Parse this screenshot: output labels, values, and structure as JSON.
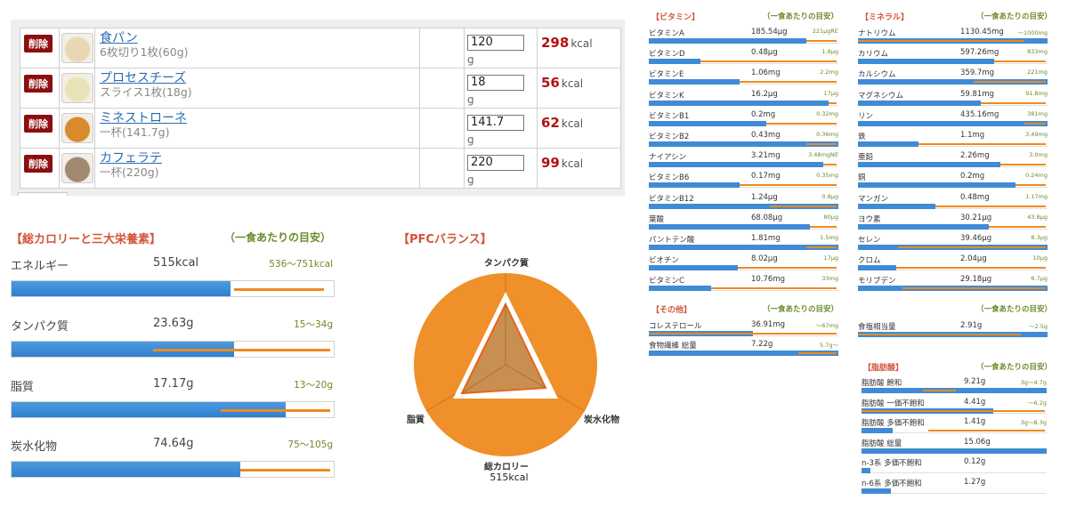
{
  "foods": [
    {
      "delete_label": "削除",
      "name": "食パン",
      "portion": "6枚切り1枚(60g)",
      "qty": "120",
      "unit": "g",
      "kcal": "298",
      "kcal_unit": "kcal",
      "thumb_color": "#e9d7b4"
    },
    {
      "delete_label": "削除",
      "name": "プロセスチーズ",
      "portion": "スライス1枚(18g)",
      "qty": "18",
      "unit": "g",
      "kcal": "56",
      "kcal_unit": "kcal",
      "thumb_color": "#ece2b8"
    },
    {
      "delete_label": "削除",
      "name": "ミネストローネ",
      "portion": "一杯(141.7g)",
      "qty": "141.7",
      "unit": "g",
      "kcal": "62",
      "kcal_unit": "kcal",
      "thumb_color": "#d98a2a"
    },
    {
      "delete_label": "削除",
      "name": "カフェラテ",
      "portion": "一杯(220g)",
      "qty": "220",
      "unit": "g",
      "kcal": "99",
      "kcal_unit": "kcal",
      "thumb_color": "#a08a70"
    }
  ],
  "macros": {
    "title": "【総カロリーと三大栄養素】",
    "guide_title": "（一食あたりの目安）",
    "rows": [
      {
        "label": "エネルギー",
        "value": "515kcal",
        "guide": "536〜751kcal",
        "fill": 0.68,
        "guide_min": 0.69,
        "guide_max": 0.97
      },
      {
        "label": "タンパク質",
        "value": "23.63g",
        "guide": "15〜34g",
        "fill": 0.69,
        "guide_min": 0.44,
        "guide_max": 0.99
      },
      {
        "label": "脂質",
        "value": "17.17g",
        "guide": "13〜20g",
        "fill": 0.85,
        "guide_min": 0.65,
        "guide_max": 0.99
      },
      {
        "label": "炭水化物",
        "value": "74.64g",
        "guide": "75〜105g",
        "fill": 0.71,
        "guide_min": 0.71,
        "guide_max": 0.99
      }
    ]
  },
  "pfc": {
    "title": "【PFCバランス】",
    "label_top": "タンパク質",
    "label_left": "脂質",
    "label_right": "炭水化物",
    "label_bottom": "総カロリー",
    "label_bottom_value": "515kcal",
    "colors": {
      "outer": "#ef8f2a",
      "inner": "#c9914f"
    }
  },
  "vitamins": {
    "title": "【ビタミン】",
    "guide_title": "（一食あたりの目安）",
    "rows": [
      {
        "label": "ビタミンA",
        "value": "185.54μg",
        "guide": "221μgRE",
        "fill": 0.83,
        "guide_min": 0.83,
        "guide_max": 0.99
      },
      {
        "label": "ビタミンD",
        "value": "0.48μg",
        "guide": "1.8μg",
        "fill": 0.27,
        "guide_min": 0.27,
        "guide_max": 0.99
      },
      {
        "label": "ビタミンE",
        "value": "1.06mg",
        "guide": "2.2mg",
        "fill": 0.48,
        "guide_min": 0.48,
        "guide_max": 0.99
      },
      {
        "label": "ビタミンK",
        "value": "16.2μg",
        "guide": "17μg",
        "fill": 0.95,
        "guide_min": 0.95,
        "guide_max": 0.99
      },
      {
        "label": "ビタミンB1",
        "value": "0.2mg",
        "guide": "0.32mg",
        "fill": 0.62,
        "guide_min": 0.62,
        "guide_max": 0.99
      },
      {
        "label": "ビタミンB2",
        "value": "0.43mg",
        "guide": "0.36mg",
        "fill": 1.0,
        "guide_min": 0.83,
        "guide_max": 0.99
      },
      {
        "label": "ナイアシン",
        "value": "3.21mg",
        "guide": "3.48mgNE",
        "fill": 0.92,
        "guide_min": 0.92,
        "guide_max": 0.99
      },
      {
        "label": "ビタミンB6",
        "value": "0.17mg",
        "guide": "0.35mg",
        "fill": 0.48,
        "guide_min": 0.48,
        "guide_max": 0.99
      },
      {
        "label": "ビタミンB12",
        "value": "1.24μg",
        "guide": "0.8μg",
        "fill": 1.0,
        "guide_min": 0.64,
        "guide_max": 0.99
      },
      {
        "label": "葉酸",
        "value": "68.08μg",
        "guide": "80μg",
        "fill": 0.85,
        "guide_min": 0.85,
        "guide_max": 0.99
      },
      {
        "label": "パントテン酸",
        "value": "1.81mg",
        "guide": "1.5mg",
        "fill": 1.0,
        "guide_min": 0.83,
        "guide_max": 0.99
      },
      {
        "label": "ビオチン",
        "value": "8.02μg",
        "guide": "17μg",
        "fill": 0.47,
        "guide_min": 0.47,
        "guide_max": 0.99
      },
      {
        "label": "ビタミンC",
        "value": "10.76mg",
        "guide": "33mg",
        "fill": 0.33,
        "guide_min": 0.33,
        "guide_max": 0.99
      }
    ]
  },
  "minerals": {
    "title": "【ミネラル】",
    "guide_title": "（一食あたりの目安）",
    "rows": [
      {
        "label": "ナトリウム",
        "value": "1130.45mg",
        "guide": "〜1000mg",
        "fill": 1.0,
        "guide_min": 0.0,
        "guide_max": 0.88
      },
      {
        "label": "カリウム",
        "value": "597.26mg",
        "guide": "833mg",
        "fill": 0.72,
        "guide_min": 0.72,
        "guide_max": 0.99
      },
      {
        "label": "カルシウム",
        "value": "359.7mg",
        "guide": "221mg",
        "fill": 1.0,
        "guide_min": 0.61,
        "guide_max": 0.99
      },
      {
        "label": "マグネシウム",
        "value": "59.81mg",
        "guide": "91.8mg",
        "fill": 0.65,
        "guide_min": 0.65,
        "guide_max": 0.99
      },
      {
        "label": "リン",
        "value": "435.16mg",
        "guide": "381mg",
        "fill": 1.0,
        "guide_min": 0.88,
        "guide_max": 0.99
      },
      {
        "label": "鉄",
        "value": "1.1mg",
        "guide": "3.49mg",
        "fill": 0.32,
        "guide_min": 0.32,
        "guide_max": 0.99
      },
      {
        "label": "亜鉛",
        "value": "2.26mg",
        "guide": "3.0mg",
        "fill": 0.75,
        "guide_min": 0.75,
        "guide_max": 0.99
      },
      {
        "label": "銅",
        "value": "0.2mg",
        "guide": "0.24mg",
        "fill": 0.83,
        "guide_min": 0.83,
        "guide_max": 0.99
      },
      {
        "label": "マンガン",
        "value": "0.48mg",
        "guide": "1.17mg",
        "fill": 0.41,
        "guide_min": 0.41,
        "guide_max": 0.99
      },
      {
        "label": "ヨウ素",
        "value": "30.21μg",
        "guide": "43.8μg",
        "fill": 0.69,
        "guide_min": 0.69,
        "guide_max": 0.99
      },
      {
        "label": "セレン",
        "value": "39.46μg",
        "guide": "8.3μg",
        "fill": 1.0,
        "guide_min": 0.21,
        "guide_max": 0.99
      },
      {
        "label": "クロム",
        "value": "2.04μg",
        "guide": "10μg",
        "fill": 0.2,
        "guide_min": 0.2,
        "guide_max": 0.99
      },
      {
        "label": "モリブデン",
        "value": "29.18μg",
        "guide": "6.7μg",
        "fill": 1.0,
        "guide_min": 0.23,
        "guide_max": 0.99
      }
    ]
  },
  "others": {
    "title": "【その他】",
    "guide_title": "（一食あたりの目安）",
    "rows": [
      {
        "label": "コレステロール",
        "value": "36.91mg",
        "guide": "〜67mg",
        "fill": 0.55,
        "guide_min": 0.0,
        "guide_max": 0.99
      },
      {
        "label": "食物繊維 総量",
        "value": "7.22g",
        "guide": "5.7g〜",
        "fill": 1.0,
        "guide_min": 0.79,
        "guide_max": 0.99
      }
    ]
  },
  "salt": {
    "guide_title": "（一食あたりの目安）",
    "rows": [
      {
        "label": "食塩相当量",
        "value": "2.91g",
        "guide": "〜2.5g",
        "fill": 1.0,
        "guide_min": 0.0,
        "guide_max": 0.86
      }
    ]
  },
  "fats": {
    "title": "【脂肪酸】",
    "guide_title": "（一食あたりの目安）",
    "rows": [
      {
        "label": "脂肪酸 飽和",
        "value": "9.21g",
        "guide": "3g〜4.7g",
        "fill": 1.0,
        "guide_min": 0.33,
        "guide_max": 0.51
      },
      {
        "label": "脂肪酸 一価不飽和",
        "value": "4.41g",
        "guide": "〜6.2g",
        "fill": 0.71,
        "guide_min": 0.0,
        "guide_max": 0.99
      },
      {
        "label": "脂肪酸 多価不飽和",
        "value": "1.41g",
        "guide": "3g〜8.3g",
        "fill": 0.17,
        "guide_min": 0.36,
        "guide_max": 0.99
      },
      {
        "label": "脂肪酸 総量",
        "value": "15.06g",
        "guide": "",
        "fill": 1.0,
        "guide_min": 0.0,
        "guide_max": 0.0
      },
      {
        "label": "n-3系 多価不飽和",
        "value": "0.12g",
        "guide": "",
        "fill": 0.05,
        "guide_min": 0.0,
        "guide_max": 0.0
      },
      {
        "label": "n-6系 多価不飽和",
        "value": "1.27g",
        "guide": "",
        "fill": 0.16,
        "guide_min": 0.0,
        "guide_max": 0.0
      }
    ]
  }
}
